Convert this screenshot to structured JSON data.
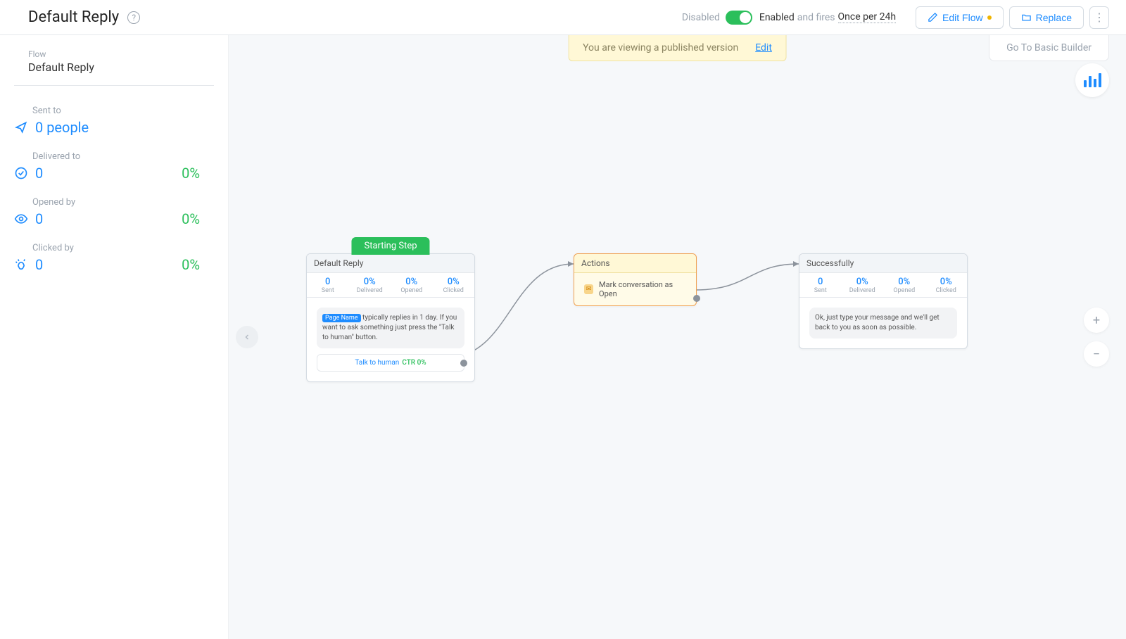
{
  "header": {
    "title": "Default Reply",
    "disabled": "Disabled",
    "enabled": "Enabled",
    "fires_prefix": "and fires",
    "fires_freq": "Once per 24h",
    "edit_flow": "Edit Flow",
    "replace": "Replace"
  },
  "banner": {
    "text": "You are viewing a published version",
    "edit": "Edit"
  },
  "basic_builder": "Go To Basic Builder",
  "sidebar": {
    "flow_label": "Flow",
    "flow_name": "Default Reply",
    "sent": {
      "label": "Sent to",
      "value": "0 people"
    },
    "delivered": {
      "label": "Delivered to",
      "value": "0",
      "pct": "0%"
    },
    "opened": {
      "label": "Opened by",
      "value": "0",
      "pct": "0%"
    },
    "clicked": {
      "label": "Clicked by",
      "value": "0",
      "pct": "0%"
    }
  },
  "nodes": {
    "starting_badge": "Starting Step",
    "n1": {
      "title": "Default Reply",
      "stats": [
        {
          "val": "0",
          "lbl": "Sent"
        },
        {
          "val": "0%",
          "lbl": "Delivered"
        },
        {
          "val": "0%",
          "lbl": "Opened"
        },
        {
          "val": "0%",
          "lbl": "Clicked"
        }
      ],
      "page_name": "Page Name",
      "msg_rest": " typically replies in 1 day. If you want to ask something just press the \"Talk to human\" button.",
      "talk_label": "Talk to human",
      "ctr": "CTR 0%"
    },
    "n2": {
      "title": "Actions",
      "action": "Mark conversation as Open"
    },
    "n3": {
      "title": "Successfully",
      "stats": [
        {
          "val": "0",
          "lbl": "Sent"
        },
        {
          "val": "0%",
          "lbl": "Delivered"
        },
        {
          "val": "0%",
          "lbl": "Opened"
        },
        {
          "val": "0%",
          "lbl": "Clicked"
        }
      ],
      "msg": "Ok, just type your message and we'll get back to you as soon as possible."
    }
  }
}
